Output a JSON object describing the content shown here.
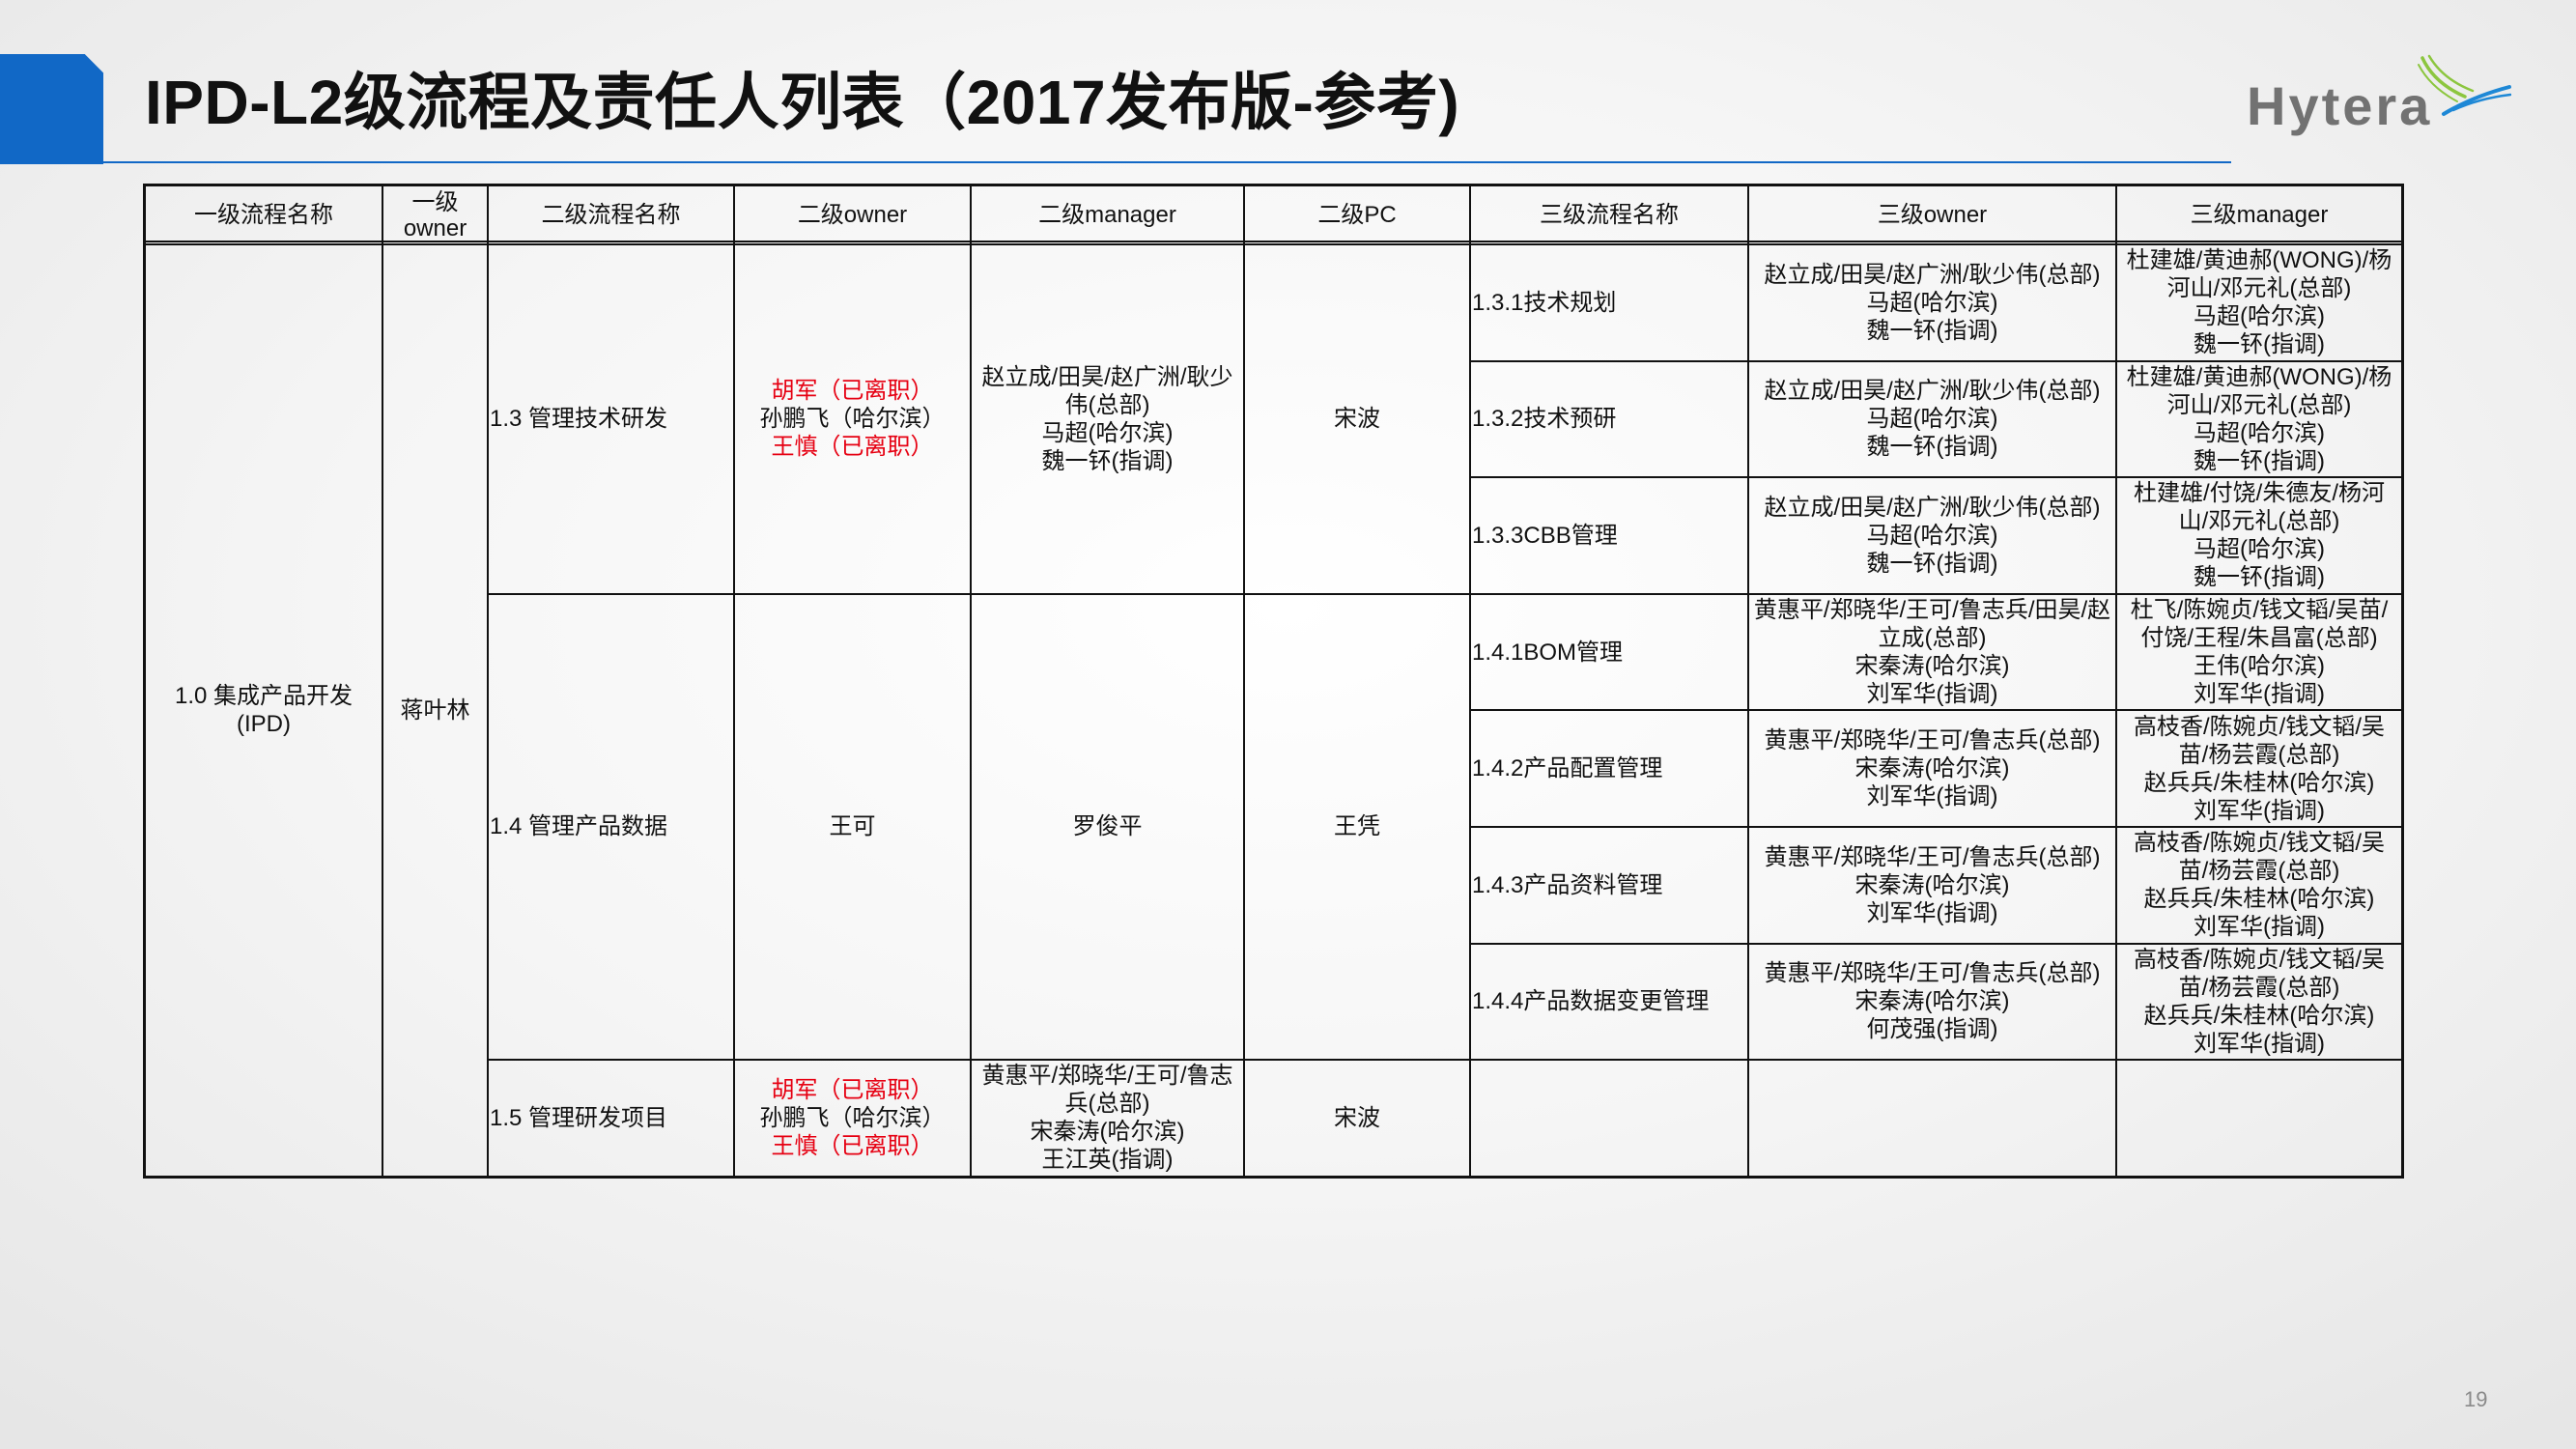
{
  "slide": {
    "title": "IPD-L2级流程及责任人列表（2017发布版-参考)",
    "logo_text": "Hytera",
    "page_number": "19"
  },
  "colors": {
    "accent_blue": "#1168c6",
    "text": "#111111",
    "logo_gray": "#727272",
    "logo_green": "#8cc63f",
    "logo_blue": "#1e88d6",
    "page_number": "#8a8a8a"
  },
  "table": {
    "headers": [
      "一级流程名称",
      "一级\nowner",
      "二级流程名称",
      "二级owner",
      "二级manager",
      "二级PC",
      "三级流程名称",
      "三级owner",
      "三级manager"
    ],
    "level1": {
      "name": "1.0 集成产品开发 (IPD)",
      "owner": "蒋叶林"
    },
    "level2": [
      {
        "name": "1.3 管理技术研发",
        "owner": [
          {
            "text": "胡军（已离职）",
            "color": "#e60012"
          },
          {
            "text": "孙鹏飞（哈尔滨）"
          },
          {
            "text": "王慎（已离职）",
            "color": "#e60012"
          }
        ],
        "manager": [
          "赵立成/田昊/赵广洲/耿少伟(总部)",
          "马超(哈尔滨)",
          "魏一钚(指调)"
        ],
        "pc": "宋波",
        "level3": [
          {
            "name": "1.3.1技术规划",
            "owner": [
              "赵立成/田昊/赵广洲/耿少伟(总部)",
              "马超(哈尔滨)",
              "魏一钚(指调)"
            ],
            "manager": [
              "杜建雄/黄迪郝(WONG)/杨河山/邓元礼(总部)",
              "马超(哈尔滨)",
              "魏一钚(指调)"
            ]
          },
          {
            "name": "1.3.2技术预研",
            "owner": [
              "赵立成/田昊/赵广洲/耿少伟(总部)",
              "马超(哈尔滨)",
              "魏一钚(指调)"
            ],
            "manager": [
              "杜建雄/黄迪郝(WONG)/杨河山/邓元礼(总部)",
              "马超(哈尔滨)",
              "魏一钚(指调)"
            ]
          },
          {
            "name": "1.3.3CBB管理",
            "owner": [
              "赵立成/田昊/赵广洲/耿少伟(总部)",
              "马超(哈尔滨)",
              "魏一钚(指调)"
            ],
            "manager": [
              "杜建雄/付饶/朱德友/杨河山/邓元礼(总部)",
              "马超(哈尔滨)",
              "魏一钚(指调)"
            ]
          }
        ]
      },
      {
        "name": "1.4 管理产品数据",
        "owner": [
          "王可"
        ],
        "manager": [
          "罗俊平"
        ],
        "pc": "王凭",
        "level3": [
          {
            "name": "1.4.1BOM管理",
            "owner": [
              "黄惠平/郑晓华/王可/鲁志兵/田昊/赵立成(总部)",
              "宋秦涛(哈尔滨)",
              "刘军华(指调)"
            ],
            "manager": [
              "杜飞/陈婉贞/钱文韬/吴苗/付饶/王程/朱昌富(总部)",
              "王伟(哈尔滨)",
              "刘军华(指调)"
            ]
          },
          {
            "name": "1.4.2产品配置管理",
            "owner": [
              "黄惠平/郑晓华/王可/鲁志兵(总部)",
              "宋秦涛(哈尔滨)",
              "刘军华(指调)"
            ],
            "manager": [
              "高枝香/陈婉贞/钱文韬/吴苗/杨芸霞(总部)",
              "赵兵兵/朱桂林(哈尔滨)",
              "刘军华(指调)"
            ]
          },
          {
            "name": "1.4.3产品资料管理",
            "owner": [
              "黄惠平/郑晓华/王可/鲁志兵(总部)",
              "宋秦涛(哈尔滨)",
              "刘军华(指调)"
            ],
            "manager": [
              "高枝香/陈婉贞/钱文韬/吴苗/杨芸霞(总部)",
              "赵兵兵/朱桂林(哈尔滨)",
              "刘军华(指调)"
            ]
          },
          {
            "name": "1.4.4产品数据变更管理",
            "owner": [
              "黄惠平/郑晓华/王可/鲁志兵(总部)",
              "宋秦涛(哈尔滨)",
              "何茂强(指调)"
            ],
            "manager": [
              "高枝香/陈婉贞/钱文韬/吴苗/杨芸霞(总部)",
              "赵兵兵/朱桂林(哈尔滨)",
              "刘军华(指调)"
            ]
          }
        ]
      },
      {
        "name": "1.5 管理研发项目",
        "owner": [
          {
            "text": "胡军（已离职）",
            "color": "#e60012"
          },
          {
            "text": "孙鹏飞（哈尔滨）"
          },
          {
            "text": "王慎（已离职）",
            "color": "#e60012"
          }
        ],
        "manager": [
          "黄惠平/郑晓华/王可/鲁志兵(总部)",
          "宋秦涛(哈尔滨)",
          "王江英(指调)"
        ],
        "pc": "宋波",
        "level3": []
      }
    ]
  }
}
